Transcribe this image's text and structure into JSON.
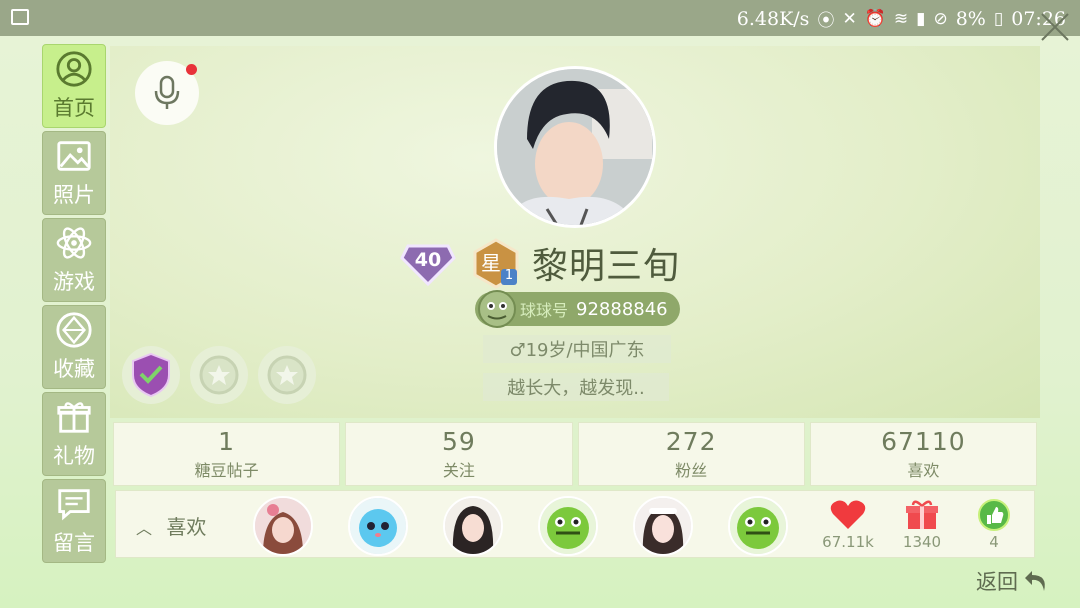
{
  "status_bar": {
    "speed": "6.48K/s",
    "battery": "8%",
    "time": "07:26"
  },
  "sidebar": {
    "items": [
      {
        "label": "首页",
        "icon": "user-circle-icon",
        "active": true
      },
      {
        "label": "照片",
        "icon": "image-icon",
        "active": false
      },
      {
        "label": "游戏",
        "icon": "atom-icon",
        "active": false
      },
      {
        "label": "收藏",
        "icon": "gem-icon",
        "active": false
      },
      {
        "label": "礼物",
        "icon": "gift-icon",
        "active": false
      },
      {
        "label": "留言",
        "icon": "message-icon",
        "active": false
      }
    ]
  },
  "profile": {
    "level": "40",
    "star_badge": "星",
    "star_level": "1",
    "name": "黎明三旬",
    "id_label": "球球号",
    "id_number": "92888846",
    "gender_age_location": "♂19岁/中国广东",
    "signature": "越长大，越发现.."
  },
  "stats": [
    {
      "value": "1",
      "label": "糖豆帖子"
    },
    {
      "value": "59",
      "label": "关注"
    },
    {
      "value": "272",
      "label": "粉丝"
    },
    {
      "value": "67110",
      "label": "喜欢"
    }
  ],
  "likes": {
    "title": "喜欢",
    "metrics": [
      {
        "icon": "heart-icon",
        "value": "67.11k",
        "color": "#f03a3e"
      },
      {
        "icon": "gift-icon",
        "value": "1340",
        "color": "#f04a4e"
      },
      {
        "icon": "thumbs-up-icon",
        "value": "4",
        "color": "#4caf3a"
      }
    ]
  },
  "back_label": "返回"
}
